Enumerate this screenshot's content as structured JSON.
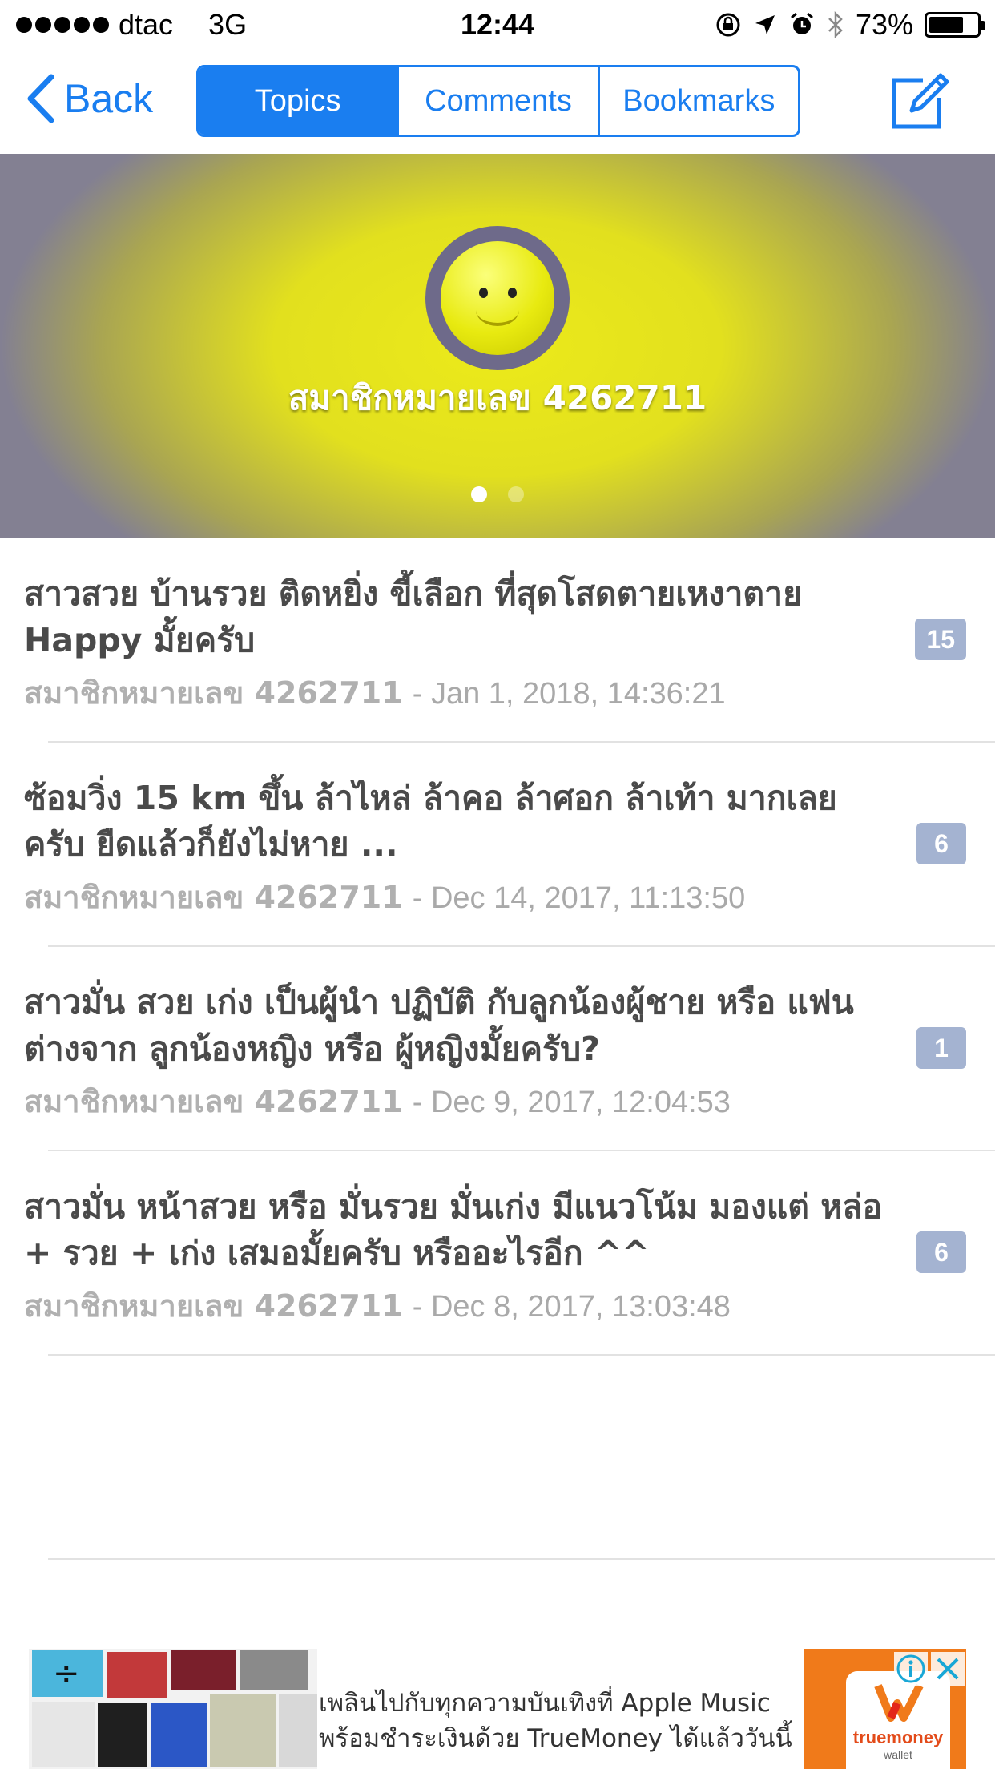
{
  "status_bar": {
    "carrier": "dtac",
    "network": "3G",
    "time": "12:44",
    "battery": "73%",
    "battery_level": 0.73
  },
  "nav": {
    "back_label": "Back",
    "tabs": [
      {
        "label": "Topics",
        "active": true
      },
      {
        "label": "Comments",
        "active": false
      },
      {
        "label": "Bookmarks",
        "active": false
      }
    ],
    "compose_icon": "compose-icon"
  },
  "profile": {
    "name": "สมาชิกหมายเลข 4262711",
    "avatar_icon": "smiley-avatar",
    "page_count": 2,
    "current_page": 1
  },
  "topics": [
    {
      "title": "สาวสวย บ้านรวย ติดหยิ่ง ขี้เลือก ที่สุดโสดตายเหงาตาย Happy มั้ยครับ",
      "author": "สมาชิกหมายเลข 4262711",
      "date": "- Jan 1, 2018, 14:36:21",
      "comments": "15"
    },
    {
      "title": "ซ้อมวิ่ง 15 km ขึ้น ล้าไหล่ ล้าคอ ล้าศอก ล้าเท้า มากเลยครับ ยืดแล้วก็ยังไม่หาย ...",
      "author": "สมาชิกหมายเลข 4262711",
      "date": "- Dec 14, 2017, 11:13:50",
      "comments": "6"
    },
    {
      "title": "สาวมั่น สวย เก่ง เป็นผู้นำ ปฏิบัติ กับลูกน้องผู้ชาย หรือ แฟน ต่างจาก ลูกน้องหญิง หรือ ผู้หญิงมั้ยครับ?",
      "author": "สมาชิกหมายเลข 4262711",
      "date": "- Dec 9, 2017, 12:04:53",
      "comments": "1"
    },
    {
      "title": "สาวมั่น หน้าสวย หรือ มั่นรวย มั่นเก่ง มีแนวโน้ม มองแต่ หล่อ + รวย + เก่ง เสมอมั้ยครับ หรืออะไรอีก ^^",
      "author": "สมาชิกหมายเลข 4262711",
      "date": "- Dec 8, 2017, 13:03:48",
      "comments": "6"
    }
  ],
  "ad": {
    "line1": "เพลินไปกับทุกความบันเทิงที่ Apple Music",
    "line2": "พร้อมชำระเงินด้วย TrueMoney ได้แล้ววันนี้",
    "logo_text": "truemoney",
    "logo_sub": "wallet"
  },
  "colors": {
    "accent": "#1a7ef0",
    "badge": "#a4b3d1",
    "banner_center": "#ecea1a"
  }
}
